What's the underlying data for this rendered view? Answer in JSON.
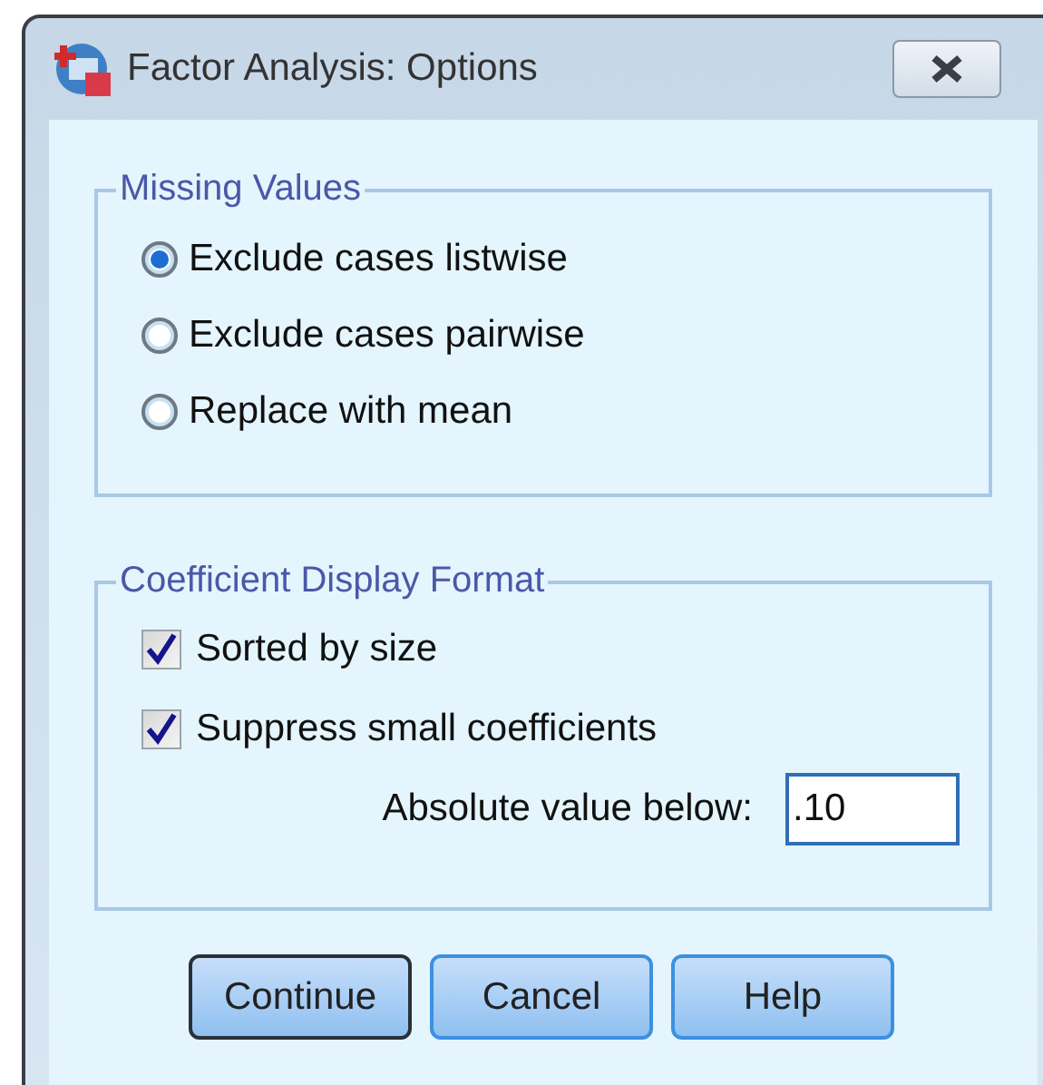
{
  "window": {
    "title": "Factor Analysis: Options"
  },
  "missing_values": {
    "title": "Missing Values",
    "options": [
      {
        "label": "Exclude cases listwise",
        "selected": true
      },
      {
        "label": "Exclude cases pairwise",
        "selected": false
      },
      {
        "label": "Replace with mean",
        "selected": false
      }
    ]
  },
  "coefficient_format": {
    "title": "Coefficient Display Format",
    "checkboxes": [
      {
        "label": "Sorted by size",
        "checked": true
      },
      {
        "label": "Suppress small coefficients",
        "checked": true
      }
    ],
    "threshold": {
      "label": "Absolute value below:",
      "value": ".10"
    }
  },
  "buttons": [
    {
      "label": "Continue",
      "default": true
    },
    {
      "label": "Cancel",
      "default": false
    },
    {
      "label": "Help",
      "default": false
    }
  ]
}
